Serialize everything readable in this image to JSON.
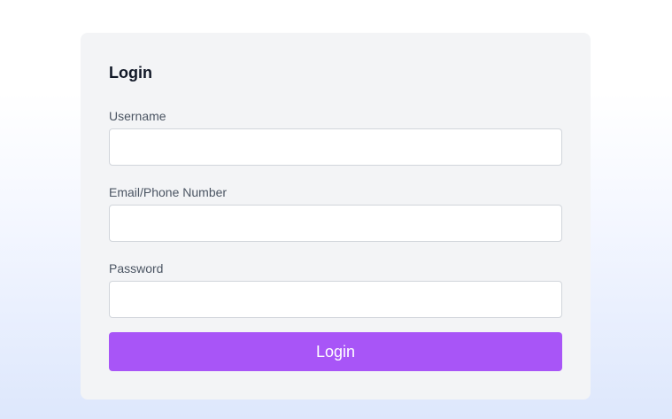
{
  "form": {
    "title": "Login",
    "fields": [
      {
        "label": "Username",
        "value": "",
        "placeholder": ""
      },
      {
        "label": "Email/Phone Number",
        "value": "",
        "placeholder": ""
      },
      {
        "label": "Password",
        "value": "",
        "placeholder": ""
      }
    ],
    "submit_label": "Login"
  },
  "colors": {
    "card_background": "#f3f4f6",
    "button_background": "#a855f7",
    "button_text": "#ffffff",
    "input_border": "#d1d5db",
    "label_text": "#4b5563",
    "title_text": "#111827"
  }
}
